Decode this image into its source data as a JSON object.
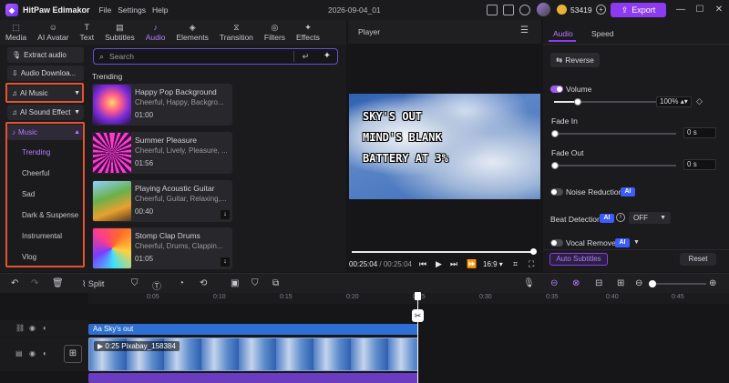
{
  "app": {
    "name": "HitPaw Edimakor",
    "menu": [
      "File",
      "Settings",
      "Help"
    ],
    "doc_title": "2026-09-04_01",
    "coins": "53419",
    "export_label": "Export"
  },
  "tabs": [
    {
      "label": "Media",
      "icon": "media-icon"
    },
    {
      "label": "AI Avatar",
      "icon": "avatar-icon"
    },
    {
      "label": "Text",
      "icon": "text-icon"
    },
    {
      "label": "Subtitles",
      "icon": "subtitles-icon"
    },
    {
      "label": "Audio",
      "icon": "music-note-icon"
    },
    {
      "label": "Elements",
      "icon": "elements-icon"
    },
    {
      "label": "Transition",
      "icon": "transition-icon"
    },
    {
      "label": "Filters",
      "icon": "filters-icon"
    },
    {
      "label": "Effects",
      "icon": "effects-icon"
    }
  ],
  "left_panel": {
    "extract": "Extract audio",
    "download": "Audio Downloa...",
    "ai_music": "AI Music",
    "ai_sound": "AI Sound Effect",
    "music": "Music",
    "music_items": [
      "Trending",
      "Cheerful",
      "Sad",
      "Dark & Suspense",
      "Instrumental",
      "Vlog"
    ]
  },
  "search": {
    "placeholder": "Search"
  },
  "section_label": "Trending",
  "cards": [
    {
      "title": "Happy Pop Background",
      "tags": "Cheerful, Happy, Backgro...",
      "duration": "01:00"
    },
    {
      "title": "Summer Pleasure",
      "tags": "Cheerful, Lively, Pleasure, ...",
      "duration": "01:56"
    },
    {
      "title": "Playing Acoustic Guitar",
      "tags": "Cheerful, Guitar, Relaxing,...",
      "duration": "00:40"
    },
    {
      "title": "Stomp Clap Drums",
      "tags": "Cheerful, Drums, Clappin...",
      "duration": "01:05"
    }
  ],
  "player": {
    "title": "Player",
    "overlay_lines": [
      "SKY'S OUT",
      "MIND'S BLANK",
      "BATTERY AT 3%"
    ],
    "current_time": "00:25:04",
    "total_time": "/ 00:25:04",
    "aspect": "16:9"
  },
  "right_panel": {
    "tabs": [
      "Audio",
      "Speed"
    ],
    "reverse": "Reverse",
    "volume_label": "Volume",
    "volume_value": 1.0,
    "volume_text": "100%",
    "fade_in_label": "Fade In",
    "fade_in_value": "0",
    "fade_in_unit": "s",
    "fade_out_label": "Fade Out",
    "fade_out_value": "0",
    "fade_out_unit": "s",
    "noise_label": "Noise Reduction",
    "beat_label": "Beat Detection",
    "beat_value": "OFF",
    "vocal_label": "Vocal Remover",
    "ai_badge": "AI",
    "auto_subtitles": "Auto Subtitles",
    "reset": "Reset"
  },
  "toolbar": {
    "split": "Split"
  },
  "ruler": [
    "0:05",
    "0:10",
    "0:15",
    "0:20",
    "0:25",
    "0:30",
    "0:35",
    "0:40",
    "0:45"
  ],
  "timeline": {
    "text_clip": "Sky's out",
    "video_clip_duration": "0:25",
    "video_clip_name": "Pixabay_158384"
  }
}
